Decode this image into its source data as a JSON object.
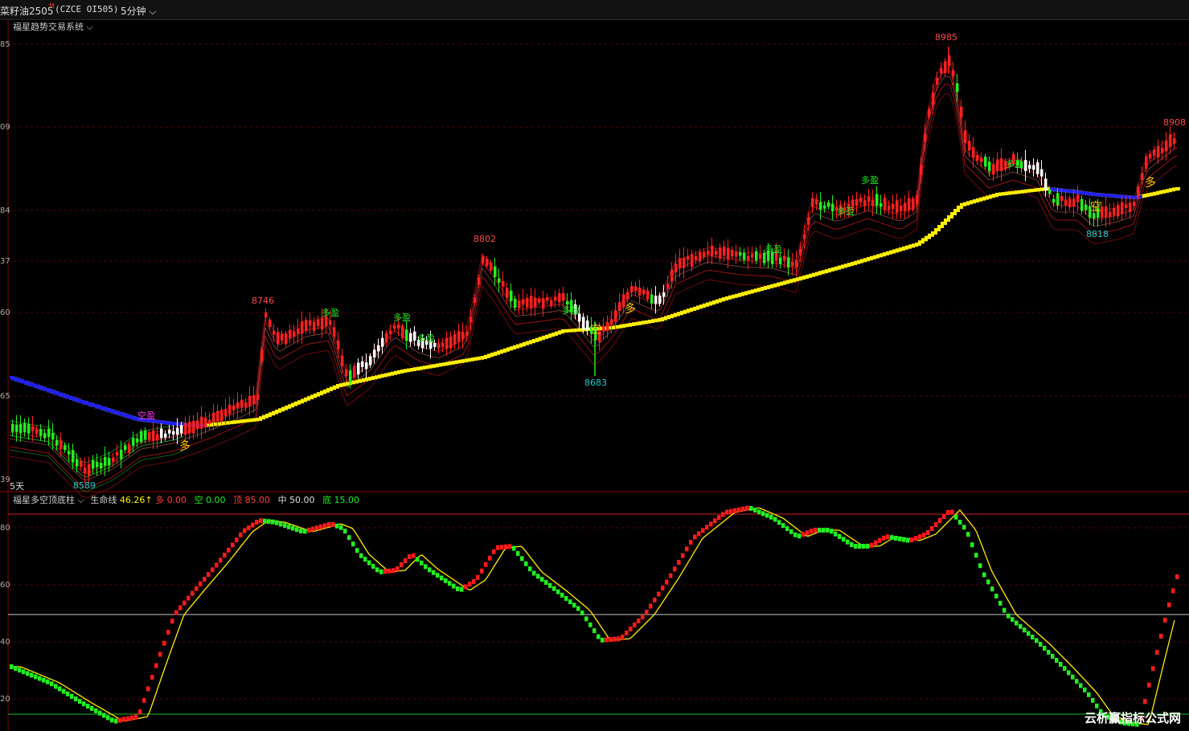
{
  "topbar": {
    "symbol": "菜籽油2505",
    "symbol_mark": "M",
    "code": "(CZCE OI505)",
    "period": "5分钟"
  },
  "main_panel": {
    "indicator_name": "福星趋势交易系统",
    "axis_labels": [
      "85",
      "09",
      "84",
      "37",
      "60",
      "65",
      "39"
    ],
    "bottom_left_label": "5天",
    "extreme_labels": [
      "8985",
      "8908",
      "8802",
      "8746",
      "8683",
      "8818",
      "8589"
    ],
    "signal_labels": {
      "duo_ying": "多盈",
      "kong_ying": "空盈",
      "duo": "多",
      "kong": "空"
    },
    "colors": {
      "up": "#ff2020",
      "down": "#22ee22",
      "lifeline_up": "#ffee00",
      "lifeline_down": "#2222ff"
    }
  },
  "sub_panel": {
    "indicator_name": "福星多空顶底柱",
    "lifeline_label": "生命线",
    "lifeline_value": "46.26",
    "lifeline_arrow": "↑",
    "duo_label": "多",
    "duo_value": "0.00",
    "kong_label": "空",
    "kong_value": "0.00",
    "top_label": "顶",
    "top_value": "85.00",
    "mid_label": "中",
    "mid_value": "50.00",
    "bottom_label": "底",
    "bottom_value": "15.00",
    "axis_labels": [
      "80",
      "60",
      "40",
      "20"
    ]
  },
  "watermark": "云析赢指标公式网"
}
